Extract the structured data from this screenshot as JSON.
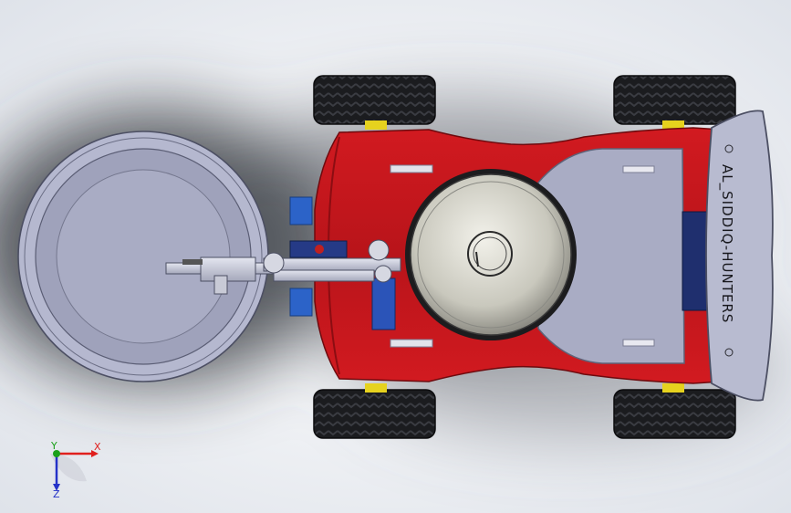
{
  "scene": {
    "background_light": "#eef0f4",
    "shadow_color": "#2e3136",
    "chassis_color": "#c4161c",
    "chassis_dark": "#8c0d12",
    "panel_color": "#a9acc4",
    "wheel_color": "#1b1c1f",
    "hub_color": "#e6d21e",
    "bowl_rim": "#b5b8cf",
    "dome_color": "#d7d6cc"
  },
  "spoiler": {
    "text": "AL_SIDDIQ-HUNTERS"
  },
  "axes": {
    "x_label": "X",
    "y_label": "Y",
    "z_label": "Z",
    "x_color": "#e0201e",
    "y_color": "#1aa01a",
    "z_color": "#2432c8"
  }
}
